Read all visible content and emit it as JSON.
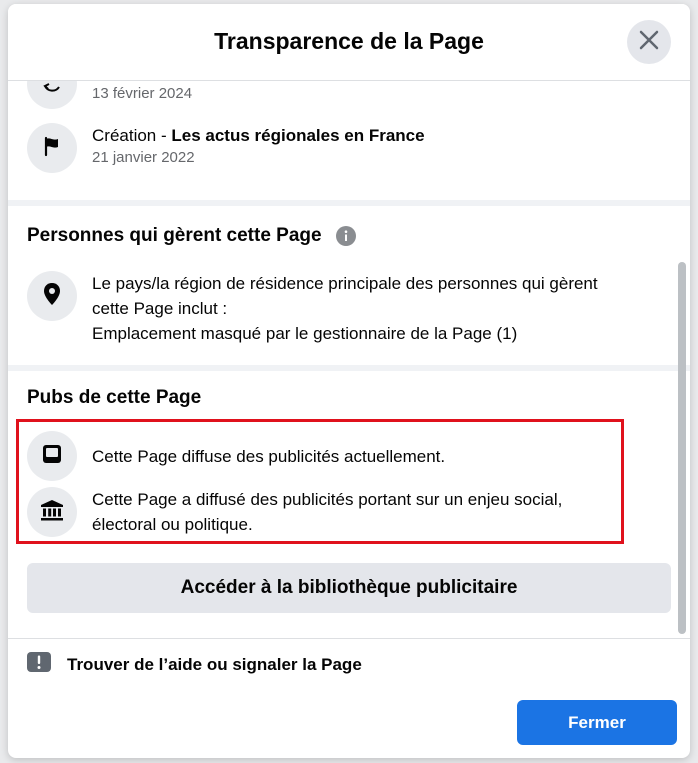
{
  "dialog": {
    "title": "Transparence de la Page",
    "close_label": "Fermer"
  },
  "history": [
    {
      "icon": "name-change-icon",
      "label": "",
      "date": "13 février 2024"
    },
    {
      "icon": "flag-icon",
      "label": "Création - ",
      "label_bold": "Les actus régionales en France",
      "date": "21 janvier 2022"
    }
  ],
  "managers": {
    "title": "Personnes qui gèrent cette Page",
    "location_line1": "Le pays/la région de résidence principale des personnes qui gèrent",
    "location_line2": "cette Page inclut :",
    "location_line3": "Emplacement masqué par le gestionnaire de la Page (1)"
  },
  "ads": {
    "title": "Pubs de cette Page",
    "item1": "Cette Page diffuse des publicités actuellement.",
    "item2_line1": "Cette Page a diffusé des publicités portant sur un enjeu social,",
    "item2_line2": "électoral ou politique.",
    "library_button": "Accéder à la bibliothèque publicitaire"
  },
  "help": {
    "label": "Trouver de l’aide ou signaler la Page"
  },
  "colors": {
    "primary": "#1b74e4",
    "highlight": "#e0111c",
    "secondary_bg": "#e4e6eb"
  }
}
